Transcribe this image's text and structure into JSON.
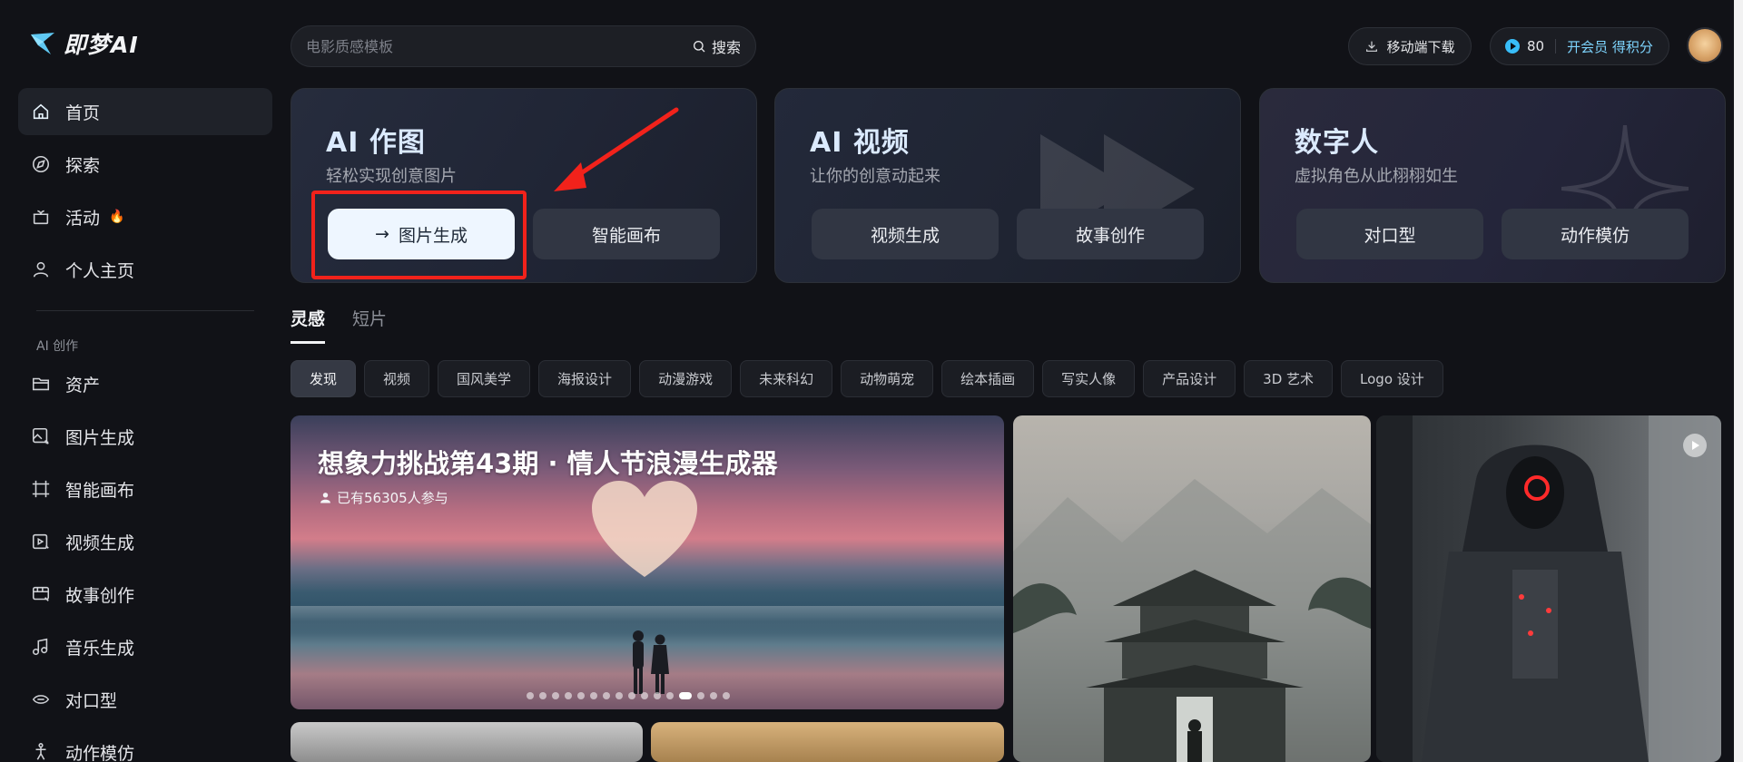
{
  "app": {
    "logo_text": "即梦AI"
  },
  "sidebar": {
    "items": [
      {
        "label": "首页",
        "icon": "home-icon",
        "active": true
      },
      {
        "label": "探索",
        "icon": "compass-icon"
      },
      {
        "label": "活动",
        "icon": "gift-icon",
        "badge_icon": "fire-icon"
      },
      {
        "label": "个人主页",
        "icon": "user-icon"
      }
    ],
    "section_label": "AI 创作",
    "create_items": [
      {
        "label": "资产",
        "icon": "folder-icon"
      },
      {
        "label": "图片生成",
        "icon": "image-gen-icon"
      },
      {
        "label": "智能画布",
        "icon": "canvas-icon"
      },
      {
        "label": "视频生成",
        "icon": "video-gen-icon"
      },
      {
        "label": "故事创作",
        "icon": "story-icon"
      },
      {
        "label": "音乐生成",
        "icon": "music-icon"
      },
      {
        "label": "对口型",
        "icon": "lipsync-icon"
      },
      {
        "label": "动作模仿",
        "icon": "motion-icon"
      }
    ]
  },
  "header": {
    "search_placeholder": "电影质感模板",
    "search_button": "搜索",
    "download_button": "移动端下载",
    "credits": "80",
    "membership_link": "开会员 得积分"
  },
  "feature_cards": [
    {
      "title": "AI 作图",
      "subtitle": "轻松实现创意图片",
      "buttons": [
        "图片生成",
        "智能画布"
      ]
    },
    {
      "title": "AI 视频",
      "subtitle": "让你的创意动起来",
      "buttons": [
        "视频生成",
        "故事创作"
      ]
    },
    {
      "title": "数字人",
      "subtitle": "虚拟角色从此栩栩如生",
      "buttons": [
        "对口型",
        "动作模仿"
      ]
    }
  ],
  "tabs": [
    {
      "label": "灵感",
      "active": true
    },
    {
      "label": "短片",
      "active": false
    }
  ],
  "categories": [
    "发现",
    "视频",
    "国风美学",
    "海报设计",
    "动漫游戏",
    "未来科幻",
    "动物萌宠",
    "绘本插画",
    "写实人像",
    "产品设计",
    "3D 艺术",
    "Logo 设计"
  ],
  "banner": {
    "title": "想象力挑战第43期 · 情人节浪漫生成器",
    "participants": "已有56305人参与",
    "slides": 16,
    "active_slide": 12
  },
  "colors": {
    "background": "#111217",
    "accent": "#7dd3fc",
    "highlight": "#f2221b"
  }
}
